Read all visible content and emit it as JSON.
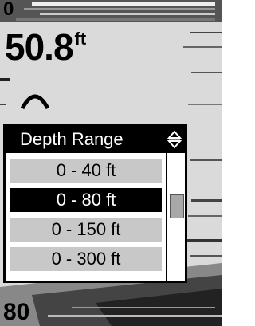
{
  "readouts": {
    "surface_value": "0",
    "depth_value": "50.8",
    "depth_unit": "ft",
    "scale_bottom": "80"
  },
  "menu": {
    "title": "Depth Range",
    "selected_index": 1,
    "items": [
      {
        "label": "0 - 40 ft"
      },
      {
        "label": "0 - 80 ft"
      },
      {
        "label": "0 - 150 ft"
      },
      {
        "label": "0 - 300 ft"
      }
    ]
  },
  "icons": {
    "scroll": "up-down-arrows-icon",
    "fish": "fish-arch-icon"
  },
  "colors": {
    "background": "#d9d9d9",
    "header": "#000000",
    "item": "#c8c8c8",
    "selected_item": "#000000"
  }
}
